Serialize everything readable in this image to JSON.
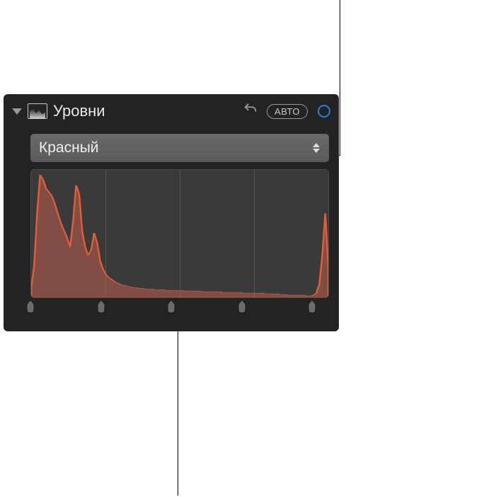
{
  "panel": {
    "title": "Уровни",
    "auto_label": "АВТО"
  },
  "dropdown": {
    "selected": "Красный"
  },
  "histogram": {
    "channel": "red",
    "fill": "rgba(188,92,77,0.55)",
    "stroke": "#e05d3c",
    "values": [
      12,
      45,
      120,
      175,
      168,
      155,
      150,
      144,
      132,
      118,
      105,
      95,
      85,
      72,
      110,
      160,
      148,
      95,
      72,
      60,
      68,
      92,
      78,
      52,
      40,
      32,
      28,
      25,
      22,
      20,
      18,
      17,
      16,
      15,
      14,
      14,
      13,
      13,
      12,
      12,
      12,
      11,
      11,
      11,
      11,
      10,
      10,
      10,
      10,
      10,
      10,
      9,
      9,
      9,
      9,
      9,
      9,
      8,
      8,
      8,
      8,
      8,
      8,
      8,
      7,
      7,
      7,
      7,
      7,
      7,
      7,
      6,
      6,
      6,
      6,
      6,
      6,
      6,
      5,
      5,
      5,
      5,
      5,
      4,
      4,
      4,
      3,
      3,
      3,
      3,
      3,
      3,
      2,
      2,
      3,
      6,
      18,
      60,
      120,
      45
    ]
  },
  "sliders": {
    "positions_pct": [
      0,
      25,
      50,
      75,
      100
    ]
  }
}
